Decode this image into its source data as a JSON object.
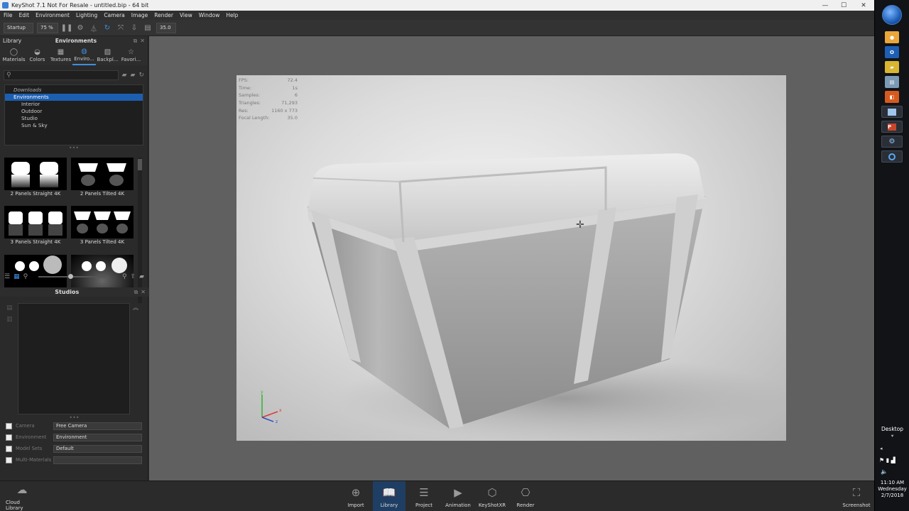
{
  "window": {
    "title": "KeyShot 7.1 Not For Resale  - untitled.bip  - 64 bit",
    "min": "—",
    "max": "☐",
    "close": "✕"
  },
  "menu": [
    "File",
    "Edit",
    "Environment",
    "Lighting",
    "Camera",
    "Image",
    "Render",
    "View",
    "Window",
    "Help"
  ],
  "toolbar": {
    "preset": "Startup",
    "zoom": "75 %",
    "focal": "35.0"
  },
  "library": {
    "panel_title": "Library",
    "section_title": "Environments",
    "tabs": [
      {
        "label": "Materials",
        "icon": "materials-icon",
        "glyph": "◯"
      },
      {
        "label": "Colors",
        "icon": "colors-icon",
        "glyph": "◒"
      },
      {
        "label": "Textures",
        "icon": "textures-icon",
        "glyph": "▦"
      },
      {
        "label": "Enviro...",
        "icon": "environments-icon",
        "glyph": "◍"
      },
      {
        "label": "Backpl...",
        "icon": "backplates-icon",
        "glyph": "▨"
      },
      {
        "label": "Favori...",
        "icon": "favorites-icon",
        "glyph": "☆"
      }
    ],
    "tree": {
      "downloads": "Downloads",
      "environments": "Environments",
      "children": [
        "Interior",
        "Outdoor",
        "Studio",
        "Sun & Sky"
      ]
    },
    "thumbnails": [
      "2 Panels Straight 4K",
      "2 Panels Tilted 4K",
      "3 Panels Straight 4K",
      "3 Panels Tilted 4K",
      "",
      ""
    ]
  },
  "studios": {
    "title": "Studios",
    "props": [
      {
        "label": "Camera",
        "value": "Free Camera"
      },
      {
        "label": "Environment",
        "value": "Environment"
      },
      {
        "label": "Model Sets",
        "value": "Default"
      },
      {
        "label": "Multi-Materials",
        "value": ""
      }
    ]
  },
  "hud": [
    {
      "k": "FPS:",
      "v": "72.4"
    },
    {
      "k": "Time:",
      "v": "1s"
    },
    {
      "k": "Samples:",
      "v": "6"
    },
    {
      "k": "Triangles:",
      "v": "71,293"
    },
    {
      "k": "Res:",
      "v": "1160 x 773"
    },
    {
      "k": "Focal Length:",
      "v": "35.0"
    }
  ],
  "gizmo": {
    "x": "x",
    "y": "y",
    "z": "z"
  },
  "bottom": {
    "cloud": "Cloud Library",
    "items": [
      "Import",
      "Library",
      "Project",
      "Animation",
      "KeyShotXR",
      "Render"
    ],
    "screenshot": "Screenshot"
  },
  "taskbar": {
    "desktop": "Desktop",
    "time": "11:10 AM",
    "day": "Wednesday",
    "date": "2/7/2018"
  },
  "colors": {
    "accent": "#3d8fe0",
    "selected": "#1c5fb0",
    "viewport": "#606060"
  }
}
